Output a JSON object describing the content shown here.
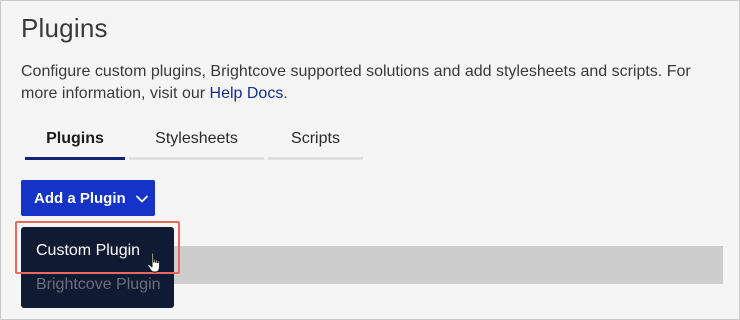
{
  "page": {
    "title": "Plugins",
    "description_text": "Configure custom plugins, Brightcove supported solutions and add stylesheets and scripts. For more information, visit our",
    "help_link": "Help Docs",
    "description_end": "."
  },
  "tabs": [
    {
      "label": "Plugins",
      "active": true
    },
    {
      "label": "Stylesheets",
      "active": false
    },
    {
      "label": "Scripts",
      "active": false
    }
  ],
  "add_button": {
    "label": "Add a Plugin",
    "icon": "chevron-down-icon"
  },
  "dropdown": {
    "items": [
      {
        "label": "Custom Plugin",
        "state": "hover"
      },
      {
        "label": "Brightcove Plugin",
        "state": "dimmed"
      }
    ]
  },
  "colors": {
    "accent": "#1533c7",
    "tab_active": "#14237a",
    "dropdown_bg": "#101a33",
    "highlight": "#e86a5e",
    "link": "#1a2d8c"
  },
  "cursor": {
    "icon": "hand-pointer-icon"
  }
}
